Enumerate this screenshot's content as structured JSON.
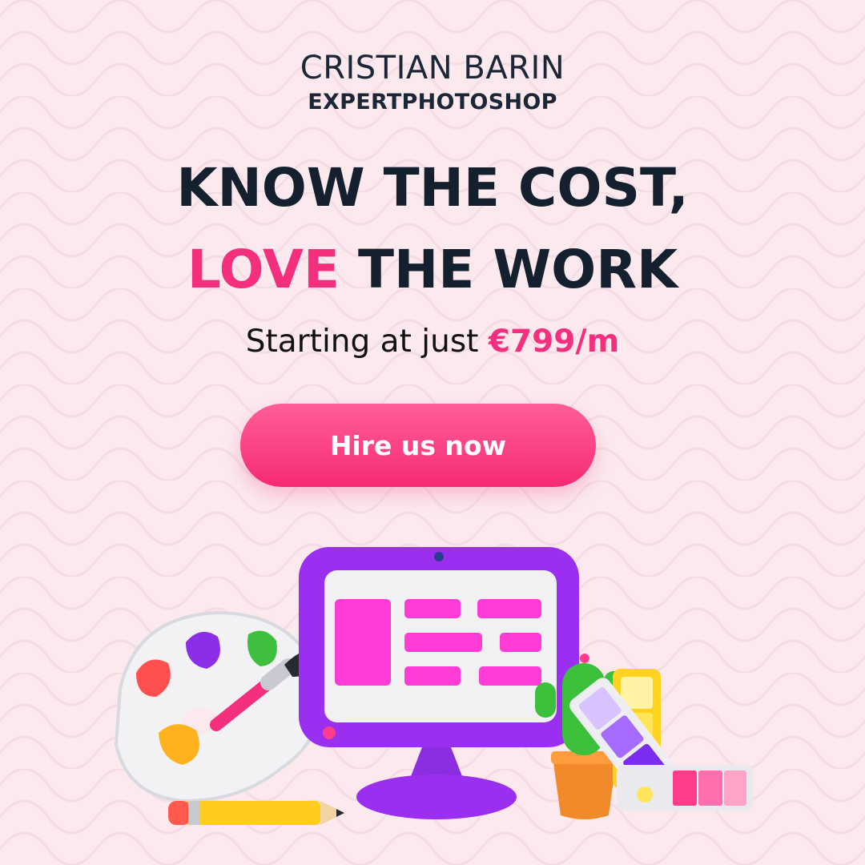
{
  "brand": {
    "name": "CRISTIAN BARIN",
    "sub": "EXPERTPHOTOSHOP"
  },
  "headline": {
    "line1": "KNOW THE COST,",
    "line2_accent": "LOVE",
    "line2_rest": " THE WORK"
  },
  "pricing": {
    "prefix": "Starting at just ",
    "price": "€799/m"
  },
  "cta": {
    "label": "Hire us now"
  },
  "colors": {
    "background": "#fbe9ee",
    "accent": "#f42f7e",
    "text_dark": "#14202e",
    "monitor": "#9b2ff0"
  },
  "illustration": {
    "icons": [
      "paint-palette-icon",
      "paintbrush-icon",
      "pencil-icon",
      "computer-monitor-icon",
      "cactus-icon",
      "color-swatches-icon"
    ]
  }
}
